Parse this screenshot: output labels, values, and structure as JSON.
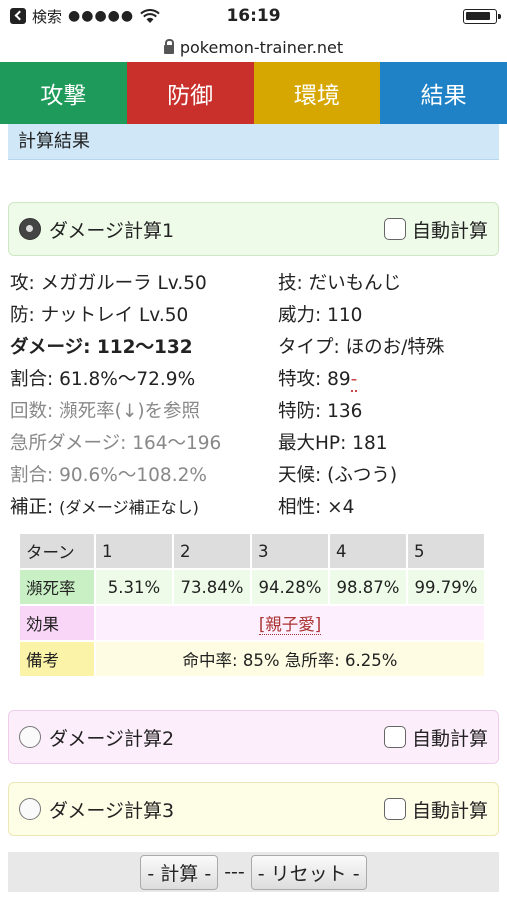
{
  "status": {
    "carrier": "検索",
    "signal": "●●●●●",
    "time": "16:19"
  },
  "browser": {
    "url": "pokemon-trainer.net"
  },
  "tabs": [
    {
      "label": "攻撃",
      "color": "#1e9a5a"
    },
    {
      "label": "防御",
      "color": "#c9302c"
    },
    {
      "label": "環境",
      "color": "#d6a700"
    },
    {
      "label": "結果",
      "color": "#1f82c6"
    }
  ],
  "result_header": "計算結果",
  "calc1": {
    "title": "ダメージ計算1",
    "auto_label": "自動計算",
    "left": {
      "attacker": "攻: メガガルーラ Lv.50",
      "defender": "防: ナットレイ Lv.50",
      "damage": "ダメージ: 112〜132",
      "ratio": "割合: 61.8%〜72.9%",
      "hits": "回数: 瀕死率(↓)を参照",
      "crit_damage": "急所ダメージ: 164〜196",
      "crit_ratio": "割合: 90.6%〜108.2%",
      "modifier_prefix": "補正: ",
      "modifier_value": "(ダメージ補正なし)"
    },
    "right": {
      "move": "技: だいもんじ",
      "power": "威力: 110",
      "type": "タイプ: ほのお/特殊",
      "spatk_prefix": "特攻: ",
      "spatk_value": "89",
      "spatk_suffix": "-",
      "spdef": "特防: 136",
      "maxhp": "最大HP: 181",
      "weather": "天候: (ふつう)",
      "effectiveness": "相性: ×4"
    },
    "table": {
      "turn_label": "ターン",
      "turns": [
        "1",
        "2",
        "3",
        "4",
        "5"
      ],
      "rate_label": "瀕死率",
      "rates": [
        "5.31%",
        "73.84%",
        "94.28%",
        "98.87%",
        "99.79%"
      ],
      "effect_label": "効果",
      "effect_value": "[親子愛]",
      "note_label": "備考",
      "note_value": "命中率: 85% 急所率: 6.25%"
    }
  },
  "calc2": {
    "title": "ダメージ計算2",
    "auto_label": "自動計算"
  },
  "calc3": {
    "title": "ダメージ計算3",
    "auto_label": "自動計算"
  },
  "footer": {
    "calc_button": "- 計算 -",
    "separator": "---",
    "reset_button": "- リセット -"
  }
}
